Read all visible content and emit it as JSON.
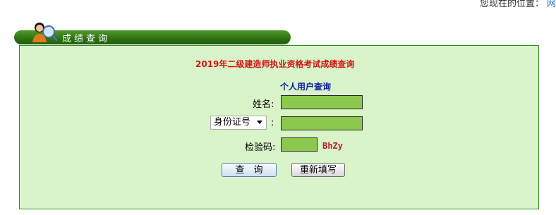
{
  "location": {
    "prefix": "您现在的位置：",
    "link": "网"
  },
  "section_title": "成绩查询",
  "page_title": "2019年二级建造师执业资格考试成绩查询",
  "sub_title": "个人用户查询",
  "form": {
    "name_label": "姓名:",
    "name_value": "",
    "id_type_selected": "身份证号",
    "id_colon": ":",
    "id_value": "",
    "captcha_label": "检验码:",
    "captcha_value": "",
    "captcha_code": "BhZy"
  },
  "buttons": {
    "query": "查　询",
    "reset": "重新填写"
  },
  "colors": {
    "panel_bg": "#d8f4c8",
    "field_bg": "#8cc84d",
    "title_red": "#d41414",
    "subtitle_blue": "#0a18a8",
    "title_bar_green": "#2f7414"
  },
  "icons": {
    "badge": "person-magnifier-icon"
  }
}
